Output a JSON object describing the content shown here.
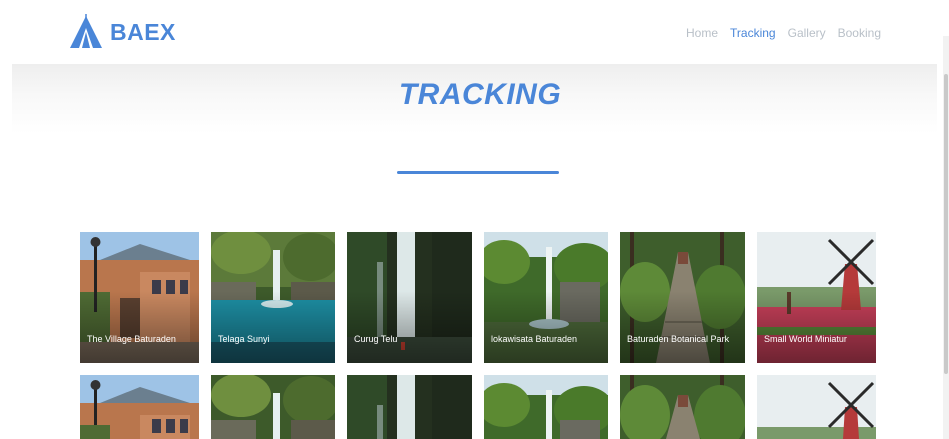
{
  "brand": {
    "name": "BAEX",
    "color": "#4a86d8"
  },
  "nav": {
    "items": [
      {
        "label": "Home",
        "active": false
      },
      {
        "label": "Tracking",
        "active": true
      },
      {
        "label": "Gallery",
        "active": false
      },
      {
        "label": "Booking",
        "active": false
      }
    ]
  },
  "page": {
    "title": "TRACKING"
  },
  "gallery": {
    "items": [
      {
        "label": "The Village Baturaden",
        "icon": "village-photo"
      },
      {
        "label": "Telaga Sunyi",
        "icon": "lake-waterfall-photo"
      },
      {
        "label": "Curug Telu",
        "icon": "waterfall-photo"
      },
      {
        "label": "lokawisata Baturaden",
        "icon": "jungle-waterfall-photo"
      },
      {
        "label": "Baturaden Botanical Park",
        "icon": "forest-path-photo"
      },
      {
        "label": "Small World Miniatur",
        "icon": "windmill-photo"
      }
    ],
    "second_row": [
      {
        "label": "",
        "icon": "village-photo"
      },
      {
        "label": "",
        "icon": "lake-waterfall-photo"
      },
      {
        "label": "",
        "icon": "waterfall-photo"
      },
      {
        "label": "",
        "icon": "jungle-waterfall-photo"
      },
      {
        "label": "",
        "icon": "forest-path-photo"
      },
      {
        "label": "",
        "icon": "windmill-photo"
      }
    ]
  }
}
